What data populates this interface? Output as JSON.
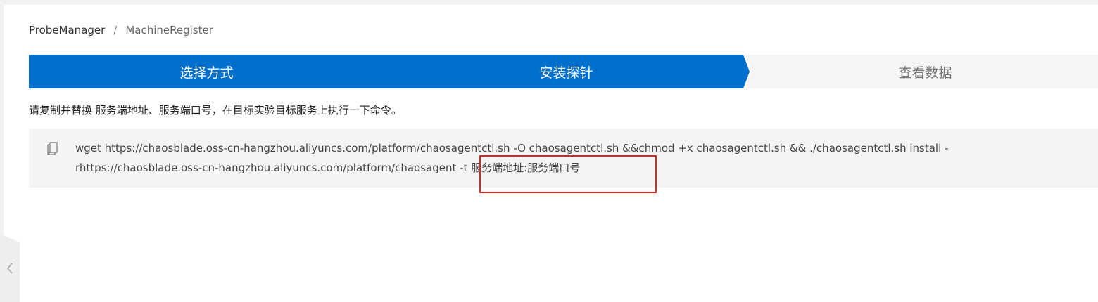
{
  "breadcrumb": {
    "root": "ProbeManager",
    "separator": "/",
    "current": "MachineRegister"
  },
  "steps": [
    {
      "label": "选择方式",
      "state": "done"
    },
    {
      "label": "安装探针",
      "state": "active"
    },
    {
      "label": "查看数据",
      "state": "pending"
    }
  ],
  "instruction": "请复制并替换 服务端地址、服务端口号，在目标实验目标服务上执行一下命令。",
  "command": {
    "line1": "wget https://chaosblade.oss-cn-hangzhou.aliyuncs.com/platform/chaosagentctl.sh -O chaosagentctl.sh &&chmod +x chaosagentctl.sh && ./chaosagentctl.sh install -",
    "line2": "rhttps://chaosblade.oss-cn-hangzhou.aliyuncs.com/platform/chaosagent -t 服务端地址:服务端口号"
  },
  "icons": {
    "copy": "copy-icon",
    "collapse": "chevron-left-icon"
  },
  "colors": {
    "step_active": "#0070cc",
    "step_pending": "#f5f5f5",
    "highlight": "#e02424"
  }
}
